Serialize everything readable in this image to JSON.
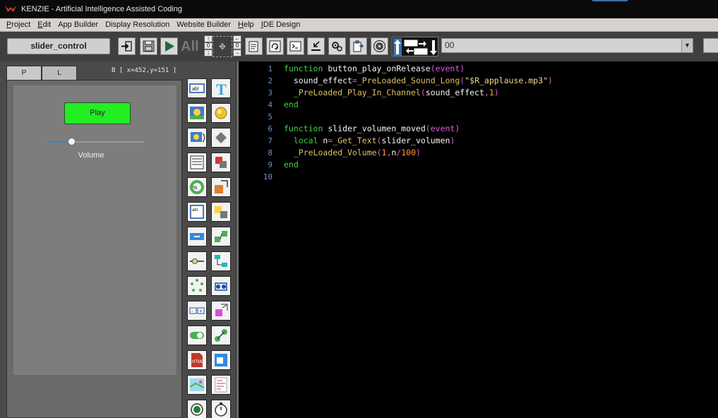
{
  "window": {
    "title": "KENZIE - Artificial Intelligence Assisted Coding"
  },
  "menu": [
    {
      "label": "Project",
      "u": "P",
      "rest": "roject"
    },
    {
      "label": "Edit",
      "u": "E",
      "rest": "dit"
    },
    {
      "label": "App Builder",
      "u": "",
      "rest": "App Builder"
    },
    {
      "label": "Display Resolution",
      "u": "",
      "rest": "Display Resolution"
    },
    {
      "label": "Website Builder",
      "u": "",
      "rest": "Website Builder"
    },
    {
      "label": "Help",
      "u": "H",
      "rest": "elp"
    },
    {
      "label": "IDE Design",
      "u": "I",
      "rest": "DE Design"
    }
  ],
  "toolbar": {
    "object_name": "slider_control",
    "all_label": "All",
    "nudge_step": "0",
    "combo_value": "00",
    "icons": [
      "exit-icon",
      "save-icon",
      "run-icon",
      "properties-icon",
      "refresh-icon",
      "terminal-icon",
      "import-icon",
      "settings-icon",
      "clipboard-icon",
      "speaker-icon"
    ]
  },
  "left_panel": {
    "tabs": [
      "P",
      "L"
    ],
    "coordinates": "B [ x=452,y=151 ]",
    "preview": {
      "button_label": "Play",
      "slider_label": "Volume",
      "slider_value": 0.24
    }
  },
  "palette": {
    "items": [
      "textbox-widget-icon",
      "text-label-icon",
      "image-widget-icon",
      "round-button-icon",
      "image-rotate-icon",
      "shape-icon",
      "listview-icon",
      "collision-icon",
      "progress-circle-icon",
      "resize-icon",
      "multiline-text-icon",
      "snap-icon",
      "button-widget-icon",
      "connect-icon",
      "slider-widget-icon",
      "tree-icon",
      "spinner-widget-icon",
      "group-move-icon",
      "stepper-widget-icon",
      "align-icon",
      "toggle-widget-icon",
      "link-icon",
      "html-widget-icon",
      "css-icon",
      "map-widget-icon",
      "text-document-icon",
      "radio-widget-icon",
      "timer-widget-icon"
    ]
  },
  "editor": {
    "line_numbers": [
      "1",
      "2",
      "3",
      "4",
      "5",
      "6",
      "7",
      "8",
      "9",
      "10"
    ],
    "lines": [
      [
        {
          "t": "function ",
          "c": "kw"
        },
        {
          "t": "button_play_onRelease",
          "c": "fn"
        },
        {
          "t": "(event)",
          "c": "par"
        }
      ],
      [
        {
          "t": "  sound_effect",
          "c": "fn"
        },
        {
          "t": "=",
          "c": "par"
        },
        {
          "t": "_PreLoaded_Sound_Long",
          "c": "call"
        },
        {
          "t": "(",
          "c": "par"
        },
        {
          "t": "\"$R_applause.mp3\"",
          "c": "str"
        },
        {
          "t": ")",
          "c": "par"
        }
      ],
      [
        {
          "t": "  _PreLoaded_Play_In_Channel",
          "c": "call"
        },
        {
          "t": "(",
          "c": "par"
        },
        {
          "t": "sound_effect",
          "c": "fn"
        },
        {
          "t": ",",
          "c": "par"
        },
        {
          "t": "1",
          "c": "num"
        },
        {
          "t": ")",
          "c": "par"
        }
      ],
      [
        {
          "t": "end",
          "c": "kw"
        }
      ],
      [
        {
          "t": "",
          "c": "fn"
        }
      ],
      [
        {
          "t": "function ",
          "c": "kw"
        },
        {
          "t": "slider_volumen_moved",
          "c": "fn"
        },
        {
          "t": "(event)",
          "c": "par"
        }
      ],
      [
        {
          "t": "  local ",
          "c": "kw"
        },
        {
          "t": "n",
          "c": "fn"
        },
        {
          "t": "=",
          "c": "par"
        },
        {
          "t": "_Get_Text",
          "c": "call"
        },
        {
          "t": "(",
          "c": "par"
        },
        {
          "t": "slider_volumen",
          "c": "fn"
        },
        {
          "t": ")",
          "c": "par"
        }
      ],
      [
        {
          "t": "  _PreLoaded_Volume",
          "c": "call"
        },
        {
          "t": "(",
          "c": "par"
        },
        {
          "t": "1",
          "c": "num"
        },
        {
          "t": ",",
          "c": "par"
        },
        {
          "t": "n",
          "c": "fn"
        },
        {
          "t": "/",
          "c": "par"
        },
        {
          "t": "100",
          "c": "num"
        },
        {
          "t": ")",
          "c": "par"
        }
      ],
      [
        {
          "t": "end",
          "c": "kw"
        }
      ],
      [
        {
          "t": "",
          "c": "fn"
        }
      ]
    ]
  },
  "colors": {
    "keyword": "#3fd23f",
    "call": "#e0c068",
    "string": "#f0d890",
    "paren": "#d65fd6",
    "number": "#ff9a3c",
    "play_button": "#22ee22",
    "slider_fill": "#3b82c4"
  }
}
